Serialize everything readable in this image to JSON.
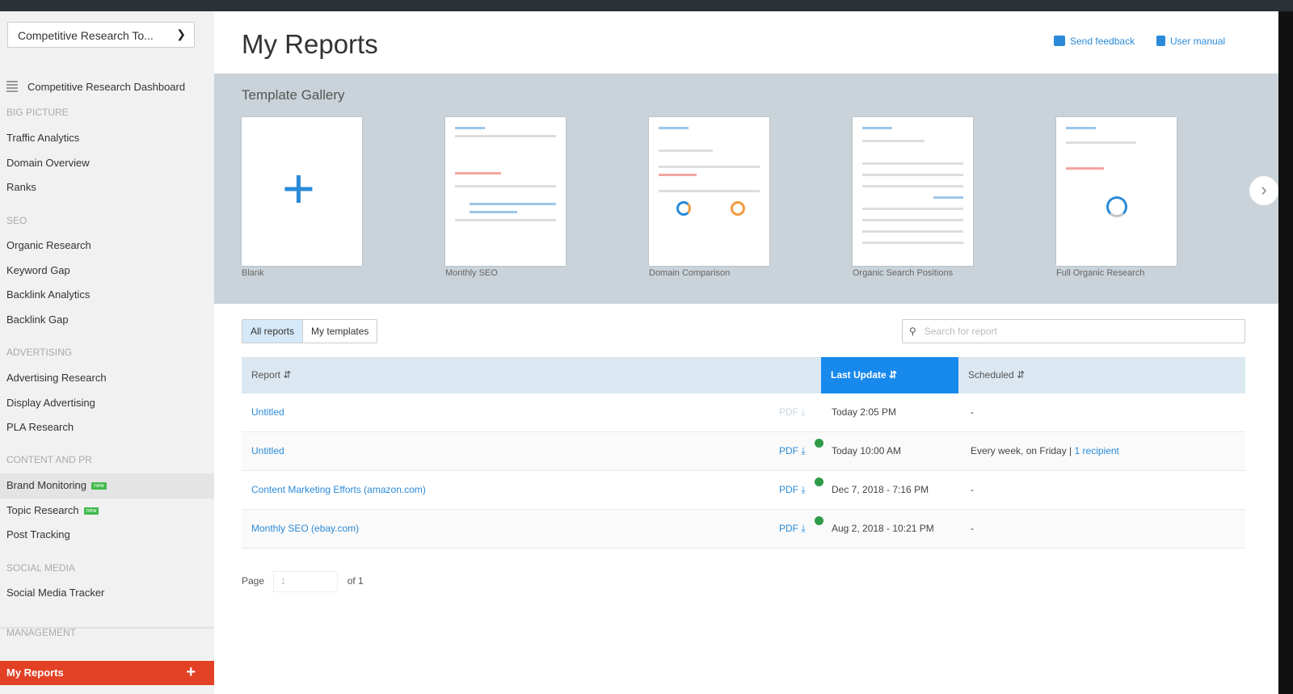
{
  "sidebar": {
    "tool_select": "Competitive Research To...",
    "dashboard": "Competitive Research Dashboard",
    "sections": [
      {
        "title": "BIG PICTURE",
        "items": [
          "Traffic Analytics",
          "Domain Overview",
          "Ranks"
        ]
      },
      {
        "title": "SEO",
        "items": [
          "Organic Research",
          "Keyword Gap",
          "Backlink Analytics",
          "Backlink Gap"
        ]
      },
      {
        "title": "ADVERTISING",
        "items": [
          "Advertising Research",
          "Display Advertising",
          "PLA Research"
        ]
      },
      {
        "title": "CONTENT AND PR",
        "items": [
          "Brand Monitoring",
          "Topic Research",
          "Post Tracking"
        ]
      },
      {
        "title": "SOCIAL MEDIA",
        "items": [
          "Social Media Tracker"
        ]
      },
      {
        "title": "MANAGEMENT",
        "items": []
      }
    ],
    "new_badge": "new",
    "my_reports": "My Reports"
  },
  "header": {
    "title": "My Reports",
    "send_feedback": "Send feedback",
    "user_manual": "User manual"
  },
  "gallery": {
    "title": "Template Gallery",
    "templates": [
      "Blank",
      "Monthly SEO",
      "Domain Comparison",
      "Organic Search Positions",
      "Full Organic Research"
    ]
  },
  "tabs": [
    "All reports",
    "My templates"
  ],
  "search": {
    "placeholder": "Search for report"
  },
  "table": {
    "headers": [
      "Report",
      "Last Update",
      "Scheduled"
    ],
    "pdf_label": "PDF",
    "rows": [
      {
        "name": "Untitled",
        "updated": "Today 2:05 PM",
        "scheduled": "-",
        "recipient": ""
      },
      {
        "name": "Untitled",
        "updated": "Today 10:00 AM",
        "scheduled": "Every week, on Friday |",
        "recipient": "1 recipient"
      },
      {
        "name": "Content Marketing Efforts (amazon.com)",
        "updated": "Dec 7, 2018 - 7:16 PM",
        "scheduled": "-",
        "recipient": ""
      },
      {
        "name": "Monthly SEO (ebay.com)",
        "updated": "Aug 2, 2018 - 10:21 PM",
        "scheduled": "-",
        "recipient": ""
      }
    ]
  },
  "pager": {
    "page_label": "Page",
    "page_value": "1",
    "of_label": "of 1"
  },
  "colors": {
    "accent": "#2a8ad8",
    "brand_red": "#e34126",
    "sorted_header": "#1889ec"
  }
}
